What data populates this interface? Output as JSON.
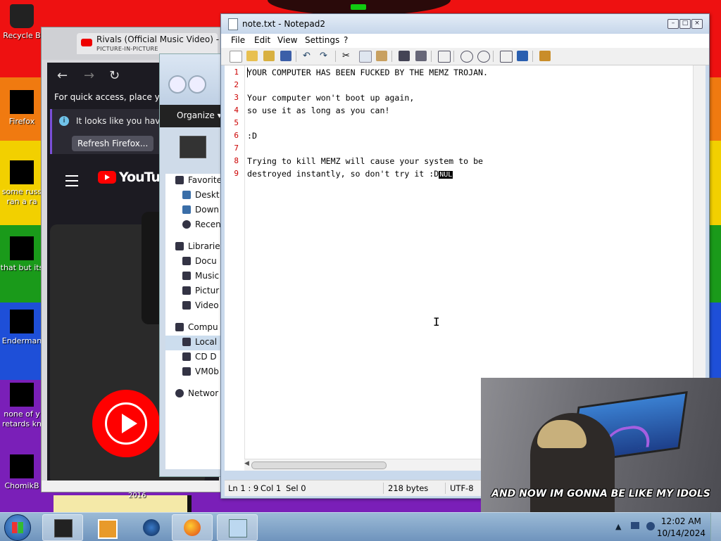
{
  "desktop": {
    "icons": [
      {
        "label": "Recycle Bin",
        "display": "Recycle B"
      },
      {
        "label": "Firefox",
        "display": "Firefox"
      },
      {
        "label": "some russ... ran a ra...",
        "display": "some russ"
      },
      {
        "label2": "ran a ra"
      },
      {
        "label": "that but its",
        "display": "that but its"
      },
      {
        "label": "Enderman",
        "display": "Enderman"
      },
      {
        "label": "none of y... retards kn...",
        "display": "none of y"
      },
      {
        "label2": "retards kn"
      },
      {
        "label": "ChomikB",
        "display": "ChomikB"
      }
    ],
    "year_text": "2016"
  },
  "firefox": {
    "tab_title": "Rivals (Official Music Video) - Y",
    "tab_subtitle": "PICTURE-IN-PICTURE",
    "quick_access": "For quick access, place your",
    "notice_text": "It looks like you haven",
    "refresh_button": "Refresh Firefox...",
    "yt_word": "YouTube"
  },
  "explorer": {
    "organize": "Organize ▾",
    "tree": [
      "Favorites",
      "Desktop",
      "Downloads",
      "Recent",
      "Libraries",
      "Documents",
      "Music",
      "Pictures",
      "Videos",
      "Computer",
      "Local Disk",
      "CD Drive",
      "VM0b",
      "Network"
    ],
    "tree_display": [
      "Favorite",
      "Deskt",
      "Down",
      "Recen",
      "Librarie",
      "Docu",
      "Music",
      "Pictur",
      "Video",
      "Compu",
      "Local",
      "CD D",
      "VM0b",
      "Networ"
    ]
  },
  "notepad": {
    "title": "note.txt - Notepad2",
    "menu": [
      "File",
      "Edit",
      "View",
      "Settings",
      "?"
    ],
    "lines": [
      "YOUR COMPUTER HAS BEEN FUCKED BY THE MEMZ TROJAN.",
      "",
      "Your computer won't boot up again,",
      "so use it as long as you can!",
      "",
      ":D",
      "",
      "Trying to kill MEMZ will cause your system to be",
      "destroyed instantly, so don't try it :D"
    ],
    "line_numbers": [
      "1",
      "2",
      "3",
      "4",
      "5",
      "6",
      "7",
      "8",
      "9"
    ],
    "nul_marker": "NUL",
    "status": {
      "position": "Ln 1 : 9",
      "col": "Col 1",
      "sel": "Sel 0",
      "size": "218 bytes",
      "encoding": "UTF-8"
    }
  },
  "pip": {
    "caption": "AND NOW IM GONNA BE LIKE MY IDOLS"
  },
  "taskbar": {
    "time": "12:02 AM",
    "date": "10/14/2024"
  },
  "colors": {
    "accent": "#1e4fd8",
    "line_number": "#cc0000",
    "youtube_red": "#ff0000"
  }
}
